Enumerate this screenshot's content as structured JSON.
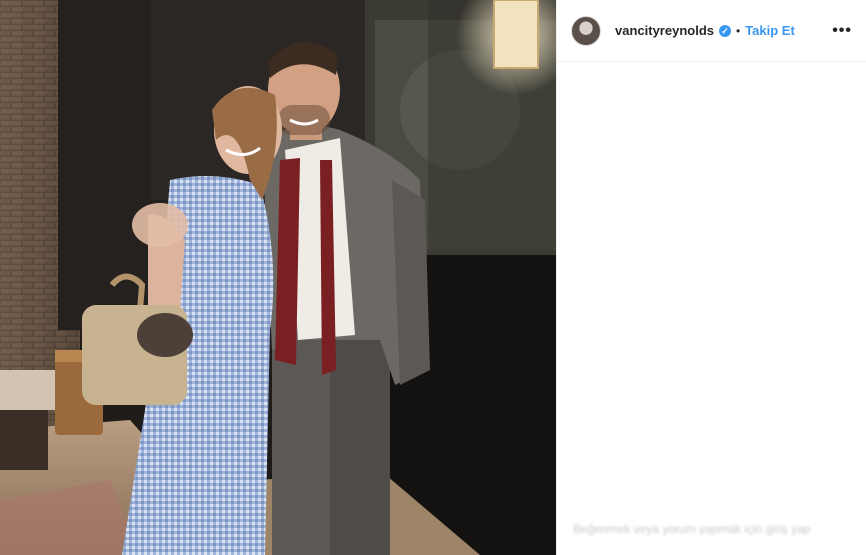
{
  "post": {
    "username": "vancityreynolds",
    "follow_label": "Takip Et",
    "separator": "•",
    "verified_mark": "✓",
    "more_label": "•••",
    "caption_partial": "Beğenmek veya yorum yapmak için giriş yap"
  },
  "icons": {
    "avatar": "avatar-icon",
    "verified": "verified-badge-icon",
    "more": "more-options-icon"
  },
  "colors": {
    "link": "#3897f0",
    "text": "#262626",
    "border": "#efefef"
  }
}
